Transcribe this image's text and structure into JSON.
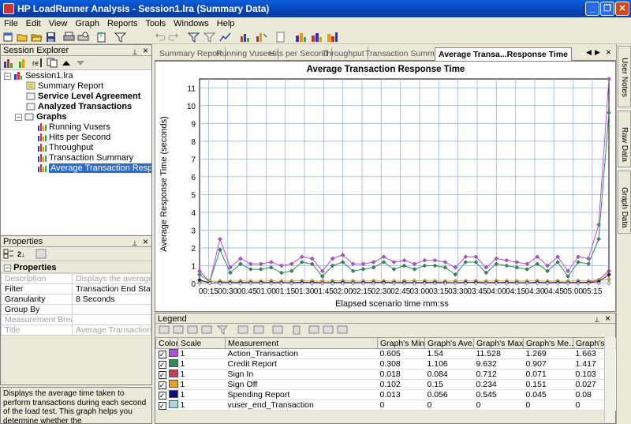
{
  "window": {
    "title": "HP LoadRunner Analysis - Session1.lra (Summary Data)",
    "min_label": "_",
    "max_label": "❐",
    "close_label": "✕"
  },
  "menu": [
    "File",
    "Edit",
    "View",
    "Graph",
    "Reports",
    "Tools",
    "Windows",
    "Help"
  ],
  "session_explorer": {
    "title": "Session Explorer",
    "pin_label": "⊥",
    "close_label": "×",
    "tree": [
      {
        "label": "Session1.lra",
        "bold": false,
        "icon": "session-icon"
      },
      {
        "label": "Summary Report",
        "bold": false,
        "icon": "report-icon"
      },
      {
        "label": "Service Level Agreement",
        "bold": true,
        "icon": "folder-icon"
      },
      {
        "label": "Analyzed Transactions",
        "bold": true,
        "icon": "folder-icon"
      },
      {
        "label": "Graphs",
        "bold": true,
        "icon": "folder-icon"
      },
      {
        "label": "Running Vusers",
        "bold": false,
        "icon": "graph-icon"
      },
      {
        "label": "Hits per Second",
        "bold": false,
        "icon": "graph-icon"
      },
      {
        "label": "Throughput",
        "bold": false,
        "icon": "graph-icon"
      },
      {
        "label": "Transaction Summary",
        "bold": false,
        "icon": "graph-icon"
      },
      {
        "label": "Average Transaction Response Time",
        "bold": false,
        "icon": "graph-icon",
        "selected": true
      }
    ]
  },
  "properties": {
    "title": "Properties",
    "section": "Properties",
    "rows": [
      {
        "key": "Description",
        "value": "Displays the average time",
        "grey": true
      },
      {
        "key": "Filter",
        "value": "Transaction End Status = (",
        "grey": false
      },
      {
        "key": "Granularity",
        "value": "8 Seconds",
        "grey": false
      },
      {
        "key": "Group By",
        "value": "",
        "grey": false
      },
      {
        "key": "Measurement Break",
        "value": "",
        "grey": true
      },
      {
        "key": "Title",
        "value": "Average Transaction Resp",
        "grey": true
      }
    ],
    "description": "Displays the average time taken to perform transactions during each second of the load test. This graph helps you determine whether the"
  },
  "tabs": [
    {
      "label": "Summary Report",
      "active": false
    },
    {
      "label": "Running Vusers",
      "active": false
    },
    {
      "label": "Hits per Second",
      "active": false
    },
    {
      "label": "Throughput",
      "active": false
    },
    {
      "label": "Transaction Summary",
      "active": false
    },
    {
      "label": "Average Transa...Response Time",
      "active": true
    }
  ],
  "tab_nav": {
    "prev": "◀",
    "next": "▶",
    "close": "×"
  },
  "chart_data": {
    "type": "line",
    "title": "Average Transaction Response Time",
    "xlabel": "Elapsed scenario time mm:ss",
    "ylabel": "Average Response Time (seconds)",
    "ylim": [
      0,
      11.5
    ],
    "yticks": [
      0,
      1,
      2,
      3,
      4,
      5,
      6,
      7,
      8,
      9,
      10,
      11
    ],
    "xticks": [
      "00:15",
      "00:30",
      "00:45",
      "01:00",
      "01:15",
      "01:30",
      "01:45",
      "02:00",
      "02:15",
      "02:30",
      "02:45",
      "03:00",
      "03:15",
      "03:30",
      "03:45",
      "04:00",
      "04:15",
      "04:30",
      "04:45",
      "05:00",
      "05:15"
    ],
    "grid": true,
    "x_seconds": [
      8,
      16,
      24,
      32,
      40,
      48,
      56,
      64,
      72,
      80,
      88,
      96,
      104,
      112,
      120,
      128,
      136,
      144,
      152,
      160,
      168,
      176,
      184,
      192,
      200,
      208,
      216,
      224,
      232,
      240,
      248,
      256,
      264,
      272,
      280,
      288,
      296,
      304,
      312,
      320,
      328
    ],
    "series": [
      {
        "name": "Action_Transaction",
        "color": "#b050e0",
        "values": [
          0.7,
          0.1,
          2.5,
          0.9,
          1.4,
          1.1,
          1.1,
          1.2,
          1.0,
          1.1,
          1.5,
          1.4,
          0.7,
          1.4,
          1.6,
          1.1,
          1.1,
          1.2,
          1.5,
          1.2,
          1.3,
          1.1,
          1.3,
          1.3,
          1.2,
          0.9,
          1.5,
          1.5,
          0.9,
          1.4,
          1.3,
          1.2,
          1.1,
          1.5,
          1.0,
          1.5,
          0.7,
          1.5,
          1.4,
          3.3,
          11.5
        ]
      },
      {
        "name": "Credit Report",
        "color": "#2e8b57",
        "values": [
          0.5,
          0.1,
          1.9,
          0.6,
          1.1,
          0.8,
          0.8,
          0.9,
          0.6,
          0.7,
          1.2,
          1.1,
          0.4,
          1.0,
          1.2,
          0.7,
          0.8,
          0.9,
          1.2,
          0.8,
          1.0,
          0.8,
          1.0,
          1.0,
          0.9,
          0.5,
          1.2,
          1.2,
          0.6,
          1.1,
          1.0,
          0.9,
          0.8,
          1.1,
          0.7,
          1.2,
          0.4,
          1.2,
          1.1,
          2.5,
          9.6
        ]
      },
      {
        "name": "Sign In",
        "color": "#c83c5a",
        "values": [
          0.02,
          0.01,
          0.05,
          0.05,
          0.06,
          0.05,
          0.04,
          0.06,
          0.05,
          0.05,
          0.06,
          0.07,
          0.05,
          0.05,
          0.06,
          0.05,
          0.05,
          0.06,
          0.07,
          0.05,
          0.06,
          0.05,
          0.06,
          0.06,
          0.05,
          0.05,
          0.06,
          0.07,
          0.05,
          0.06,
          0.06,
          0.05,
          0.05,
          0.06,
          0.05,
          0.06,
          0.05,
          0.06,
          0.06,
          0.2,
          0.7
        ]
      },
      {
        "name": "Sign Off",
        "color": "#e8a020",
        "values": [
          0.1,
          0.12,
          0.13,
          0.12,
          0.14,
          0.13,
          0.12,
          0.15,
          0.13,
          0.14,
          0.15,
          0.14,
          0.13,
          0.14,
          0.15,
          0.14,
          0.13,
          0.15,
          0.14,
          0.13,
          0.15,
          0.14,
          0.15,
          0.14,
          0.13,
          0.14,
          0.15,
          0.14,
          0.13,
          0.15,
          0.14,
          0.13,
          0.14,
          0.15,
          0.13,
          0.14,
          0.13,
          0.15,
          0.14,
          0.2,
          0.23
        ]
      },
      {
        "name": "Spending Report",
        "color": "#101080",
        "values": [
          0.2,
          0.02,
          0.05,
          0.04,
          0.05,
          0.04,
          0.05,
          0.05,
          0.04,
          0.04,
          0.06,
          0.05,
          0.03,
          0.05,
          0.06,
          0.04,
          0.05,
          0.05,
          0.06,
          0.04,
          0.05,
          0.04,
          0.05,
          0.05,
          0.04,
          0.03,
          0.06,
          0.06,
          0.03,
          0.05,
          0.05,
          0.04,
          0.04,
          0.06,
          0.04,
          0.06,
          0.03,
          0.06,
          0.05,
          0.1,
          0.5
        ]
      },
      {
        "name": "vuser_end_Transaction",
        "color": "#a8d8d8",
        "values": [
          0,
          0,
          0,
          0,
          0,
          0,
          0,
          0,
          0,
          0,
          0,
          0,
          0,
          0,
          0,
          0,
          0,
          0,
          0,
          0,
          0,
          0,
          0,
          0,
          0,
          0,
          0,
          0,
          0,
          0,
          0,
          0,
          0,
          0,
          0,
          0,
          0,
          0,
          0,
          0,
          0
        ]
      }
    ]
  },
  "legend": {
    "title": "Legend",
    "columns": [
      "Color",
      "Scale",
      "Measurement",
      "Graph's Mini...",
      "Graph's Ave...",
      "Graph's Max...",
      "Graph's Me...",
      "Graph's S"
    ],
    "rows": [
      {
        "color": "#b050e0",
        "scale": "1",
        "measurement": "Action_Transaction",
        "min": "0.605",
        "avg": "1.54",
        "max": "11.528",
        "median": "1.269",
        "sd": "1.663"
      },
      {
        "color": "#2e8b57",
        "scale": "1",
        "measurement": "Credit Report",
        "min": "0.308",
        "avg": "1.106",
        "max": "9.632",
        "median": "0.907",
        "sd": "1.417"
      },
      {
        "color": "#c83c5a",
        "scale": "1",
        "measurement": "Sign In",
        "min": "0.018",
        "avg": "0.084",
        "max": "0.712",
        "median": "0.071",
        "sd": "0.103"
      },
      {
        "color": "#e8a020",
        "scale": "1",
        "measurement": "Sign Off",
        "min": "0.102",
        "avg": "0.15",
        "max": "0.234",
        "median": "0.151",
        "sd": "0.027"
      },
      {
        "color": "#101080",
        "scale": "1",
        "measurement": "Spending Report",
        "min": "0.013",
        "avg": "0.056",
        "max": "0.545",
        "median": "0.045",
        "sd": "0.08"
      },
      {
        "color": "#a8d8d8",
        "scale": "1",
        "measurement": "vuser_end_Transaction",
        "min": "0",
        "avg": "0",
        "max": "0",
        "median": "0",
        "sd": "0"
      }
    ]
  },
  "right_panels": [
    "User Notes",
    "Raw Data",
    "Graph Data"
  ]
}
